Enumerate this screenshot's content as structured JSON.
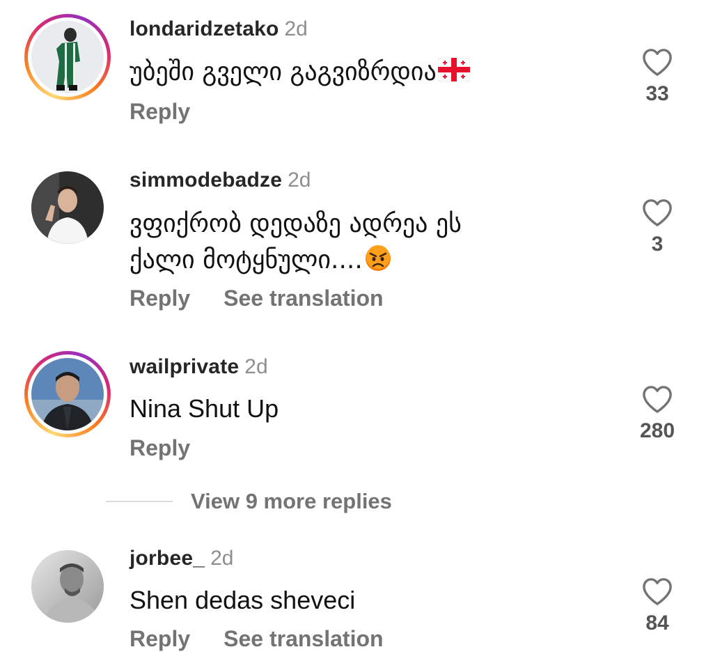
{
  "comments": [
    {
      "username": "londaridzetako",
      "time": "2d",
      "text": "უბეში გველი გაგვიზრდია",
      "reply_label": "Reply",
      "translation_label": "",
      "like_count": "33",
      "avatar_colors": {
        "bg": "#eceff1",
        "figure": "#1f6b44"
      }
    },
    {
      "username": "simmodebadze",
      "time": "2d",
      "text_line1": "ვფიქრობ დედაზე ადრეა ეს",
      "text_line2": "ქალი მოტყნული....",
      "reply_label": "Reply",
      "translation_label": "See translation",
      "like_count": "3"
    },
    {
      "username": "wailprivate",
      "time": "2d",
      "text": "Nina Shut Up",
      "reply_label": "Reply",
      "like_count": "280"
    },
    {
      "username": "jorbee_",
      "time": "2d",
      "text": "Shen dedas sheveci",
      "reply_label": "Reply",
      "translation_label": "See translation",
      "like_count": "84"
    }
  ],
  "view_more": {
    "label": "View 9 more replies"
  },
  "icons": {
    "like": "heart-outline-icon",
    "flag": "georgia-flag-emoji",
    "angry": "angry-face-emoji"
  }
}
